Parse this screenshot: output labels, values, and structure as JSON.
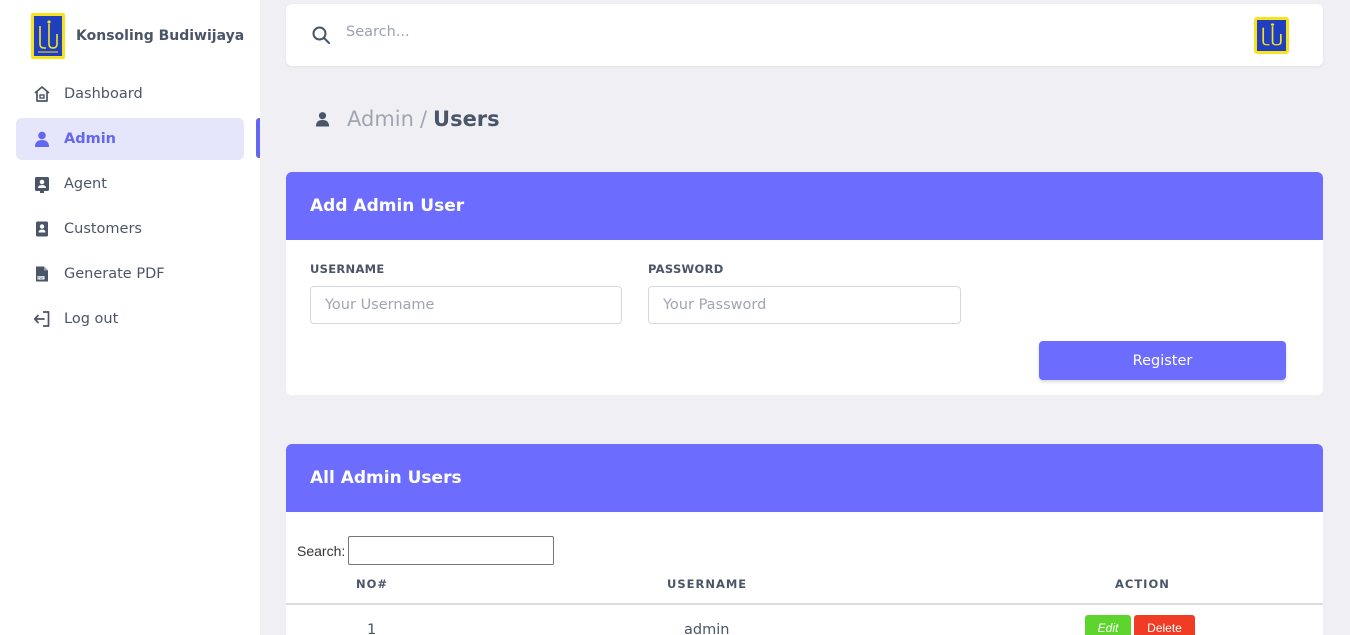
{
  "brand": {
    "name": "Konsoling Budiwijaya",
    "logo_icon": "budiwijaya-logo"
  },
  "sidebar": {
    "items": [
      {
        "label": "Dashboard",
        "icon": "home-icon",
        "active": false
      },
      {
        "label": "Admin",
        "icon": "user-icon",
        "active": true
      },
      {
        "label": "Agent",
        "icon": "id-card-icon",
        "active": false
      },
      {
        "label": "Customers",
        "icon": "contacts-icon",
        "active": false
      },
      {
        "label": "Generate PDF",
        "icon": "pdf-file-icon",
        "active": false
      },
      {
        "label": "Log out",
        "icon": "logout-icon",
        "active": false
      }
    ]
  },
  "topbar": {
    "search_placeholder": "Search..."
  },
  "breadcrumb": {
    "parent": "Admin",
    "separator": "/",
    "current": "Users"
  },
  "add_form": {
    "title": "Add Admin User",
    "username_label": "USERNAME",
    "username_placeholder": "Your Username",
    "password_label": "PASSWORD",
    "password_placeholder": "Your Password",
    "submit_label": "Register"
  },
  "users_table": {
    "title": "All Admin Users",
    "search_label": "Search:",
    "columns": [
      "NO#",
      "USERNAME",
      "ACTION"
    ],
    "rows": [
      {
        "no": "1",
        "username": "admin",
        "edit_label": "Edit",
        "delete_label": "Delete"
      }
    ]
  },
  "colors": {
    "accent": "#6c6cff",
    "active_bg": "#e5e5fb",
    "edit": "#5ed52c",
    "delete": "#f03c24",
    "logo_yellow": "#f7e31c",
    "logo_blue": "#1f3fbf"
  }
}
